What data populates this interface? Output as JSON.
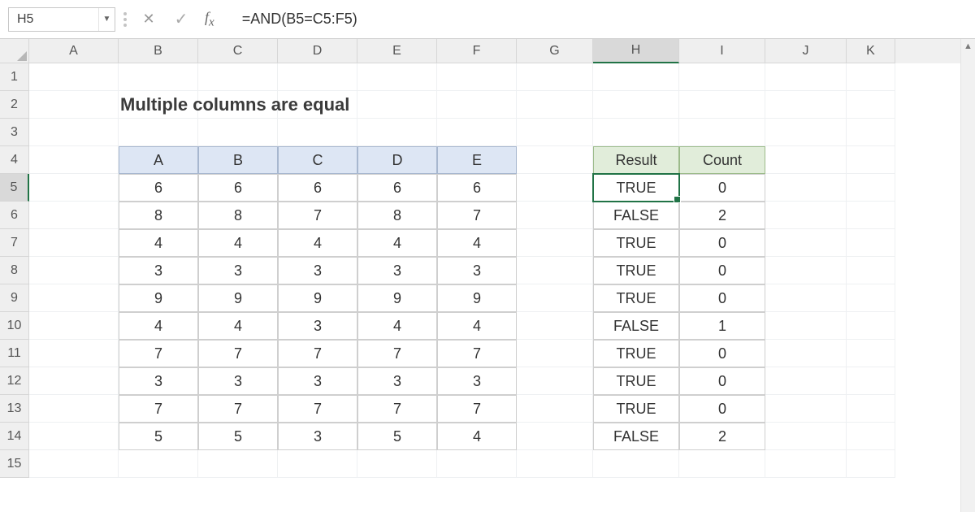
{
  "name_box": "H5",
  "formula": "=AND(B5=C5:F5)",
  "columns": [
    "A",
    "B",
    "C",
    "D",
    "E",
    "F",
    "G",
    "H",
    "I",
    "J",
    "K"
  ],
  "row_numbers": [
    1,
    2,
    3,
    4,
    5,
    6,
    7,
    8,
    9,
    10,
    11,
    12,
    13,
    14,
    15
  ],
  "active_column": "H",
  "active_row": 5,
  "title": "Multiple columns are equal",
  "data_headers": [
    "A",
    "B",
    "C",
    "D",
    "E"
  ],
  "data_rows": [
    [
      6,
      6,
      6,
      6,
      6
    ],
    [
      8,
      8,
      7,
      8,
      7
    ],
    [
      4,
      4,
      4,
      4,
      4
    ],
    [
      3,
      3,
      3,
      3,
      3
    ],
    [
      9,
      9,
      9,
      9,
      9
    ],
    [
      4,
      4,
      3,
      4,
      4
    ],
    [
      7,
      7,
      7,
      7,
      7
    ],
    [
      3,
      3,
      3,
      3,
      3
    ],
    [
      7,
      7,
      7,
      7,
      7
    ],
    [
      5,
      5,
      3,
      5,
      4
    ]
  ],
  "result_headers": [
    "Result",
    "Count"
  ],
  "result_rows": [
    [
      "TRUE",
      0
    ],
    [
      "FALSE",
      2
    ],
    [
      "TRUE",
      0
    ],
    [
      "TRUE",
      0
    ],
    [
      "TRUE",
      0
    ],
    [
      "FALSE",
      1
    ],
    [
      "TRUE",
      0
    ],
    [
      "TRUE",
      0
    ],
    [
      "TRUE",
      0
    ],
    [
      "FALSE",
      2
    ]
  ]
}
